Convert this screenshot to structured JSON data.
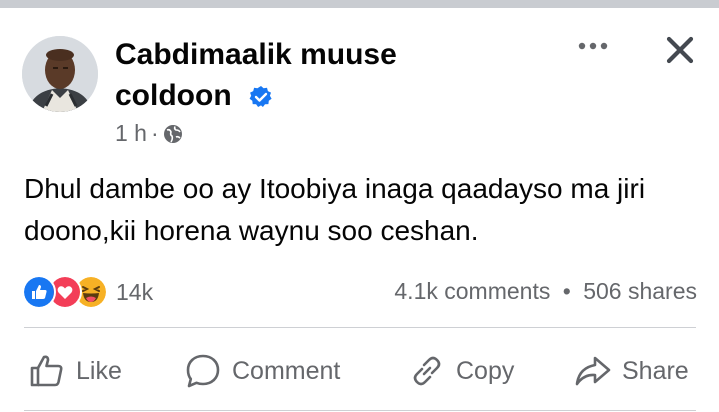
{
  "post": {
    "author": "Cabdimaalik muuse coldoon",
    "verified_icon": "verified-badge-icon",
    "time": "1 h",
    "separator": "·",
    "privacy_icon": "globe-icon",
    "text": "Dhul dambe oo ay Itoobiya inaga qaadayso ma jiri doono,kii horena waynu soo ceshan."
  },
  "header": {
    "more_icon": "more-options-icon",
    "close_icon": "close-icon"
  },
  "engagement": {
    "reactions": [
      "like",
      "love",
      "haha"
    ],
    "reaction_count": "14k",
    "comments": "4.1k comments",
    "bullet": "•",
    "shares": "506 shares"
  },
  "actions": {
    "like": "Like",
    "comment": "Comment",
    "copy": "Copy",
    "share": "Share"
  },
  "colors": {
    "like_blue": "#1877f2",
    "love_red": "#f33e58",
    "haha_yellow": "#f7b125",
    "secondary_text": "#65676b"
  }
}
